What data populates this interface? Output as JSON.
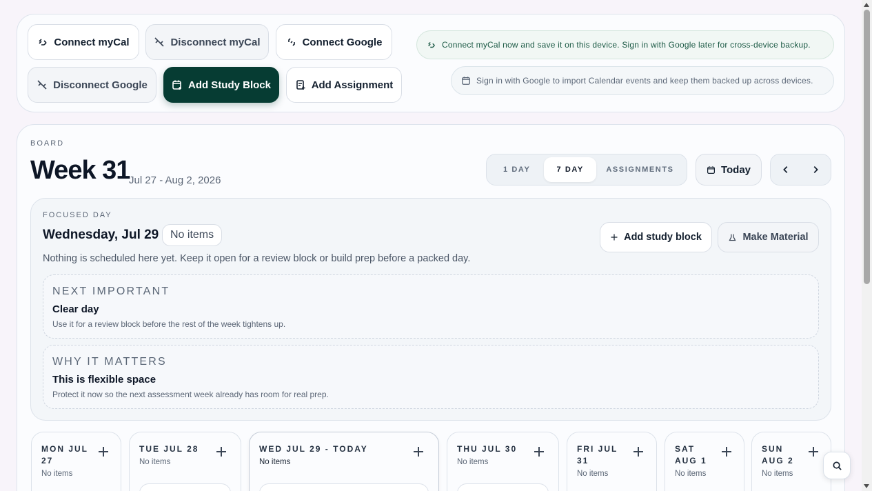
{
  "toolbar": {
    "connect_mycal": "Connect myCal",
    "disconnect_mycal": "Disconnect myCal",
    "connect_google": "Connect Google",
    "disconnect_google": "Disconnect Google",
    "add_study_block": "Add Study Block",
    "add_assignment": "Add Assignment"
  },
  "notices": {
    "mycal": "Connect myCal now and save it on this device. Sign in with Google later for cross-device backup.",
    "google": "Sign in with Google to import Calendar events and keep them backed up across devices."
  },
  "board": {
    "eyebrow": "BOARD",
    "title": "Week 31",
    "range": "Jul 27 - Aug 2, 2026",
    "views": [
      "1 DAY",
      "7 DAY",
      "ASSIGNMENTS"
    ],
    "active_view": "7 DAY",
    "today_label": "Today"
  },
  "focus": {
    "eyebrow": "FOCUSED DAY",
    "day": "Wednesday, Jul 29",
    "badge": "No items",
    "add_label": "Add study block",
    "material_label": "Make Material",
    "description": "Nothing is scheduled here yet. Keep it open for a review block or build prep before a packed day.",
    "cards": [
      {
        "heading": "NEXT IMPORTANT",
        "title": "Clear day",
        "desc": "Use it for a review block before the rest of the week tightens up."
      },
      {
        "heading": "WHY IT MATTERS",
        "title": "This is flexible space",
        "desc": "Protect it now so the next assessment week already has room for real prep."
      }
    ]
  },
  "days": [
    {
      "name_line1": "MON JUL",
      "name_line2": "27",
      "count": "No items"
    },
    {
      "name_line1": "TUE JUL 28",
      "name_line2": "",
      "count": "No items"
    },
    {
      "name_line1": "WED JUL 29 - TODAY",
      "name_line2": "",
      "count": "No items"
    },
    {
      "name_line1": "THU JUL 30",
      "name_line2": "",
      "count": "No items"
    },
    {
      "name_line1": "FRI JUL",
      "name_line2": "31",
      "count": "No items"
    },
    {
      "name_line1": "SAT",
      "name_line2": "AUG 1",
      "count": "No items"
    },
    {
      "name_line1": "SUN",
      "name_line2": "AUG 2",
      "count": "No items"
    }
  ],
  "colors": {
    "primary": "#063c33",
    "background": "#f8f4fa",
    "notice_green": "#1c5a45"
  }
}
